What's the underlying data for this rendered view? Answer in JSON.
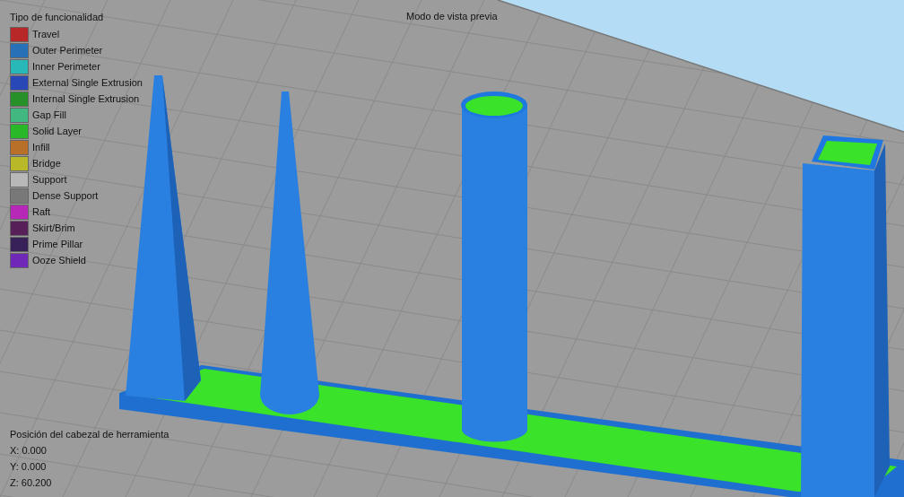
{
  "legend": {
    "title": "Tipo de funcionalidad",
    "items": [
      {
        "label": "Travel",
        "color": "#b82828"
      },
      {
        "label": "Outer Perimeter",
        "color": "#2870b8"
      },
      {
        "label": "Inner Perimeter",
        "color": "#28b8b8"
      },
      {
        "label": "External Single Extrusion",
        "color": "#2848b8"
      },
      {
        "label": "Internal Single Extrusion",
        "color": "#289028"
      },
      {
        "label": "Gap Fill",
        "color": "#40b880"
      },
      {
        "label": "Solid Layer",
        "color": "#28b828"
      },
      {
        "label": "Infill",
        "color": "#b87028"
      },
      {
        "label": "Bridge",
        "color": "#b8b828"
      },
      {
        "label": "Support",
        "color": "#b8b8b8"
      },
      {
        "label": "Dense Support",
        "color": "#787878"
      },
      {
        "label": "Raft",
        "color": "#b828b8"
      },
      {
        "label": "Skirt/Brim",
        "color": "#582058"
      },
      {
        "label": "Prime Pillar",
        "color": "#382058"
      },
      {
        "label": "Ooze Shield",
        "color": "#7028b8"
      }
    ]
  },
  "view_title": "Modo de vista previa",
  "tool_head": {
    "title": "Posición del cabezal de herramienta",
    "x": "X: 0.000",
    "y": "Y: 0.000",
    "z": "Z: 60.200"
  }
}
